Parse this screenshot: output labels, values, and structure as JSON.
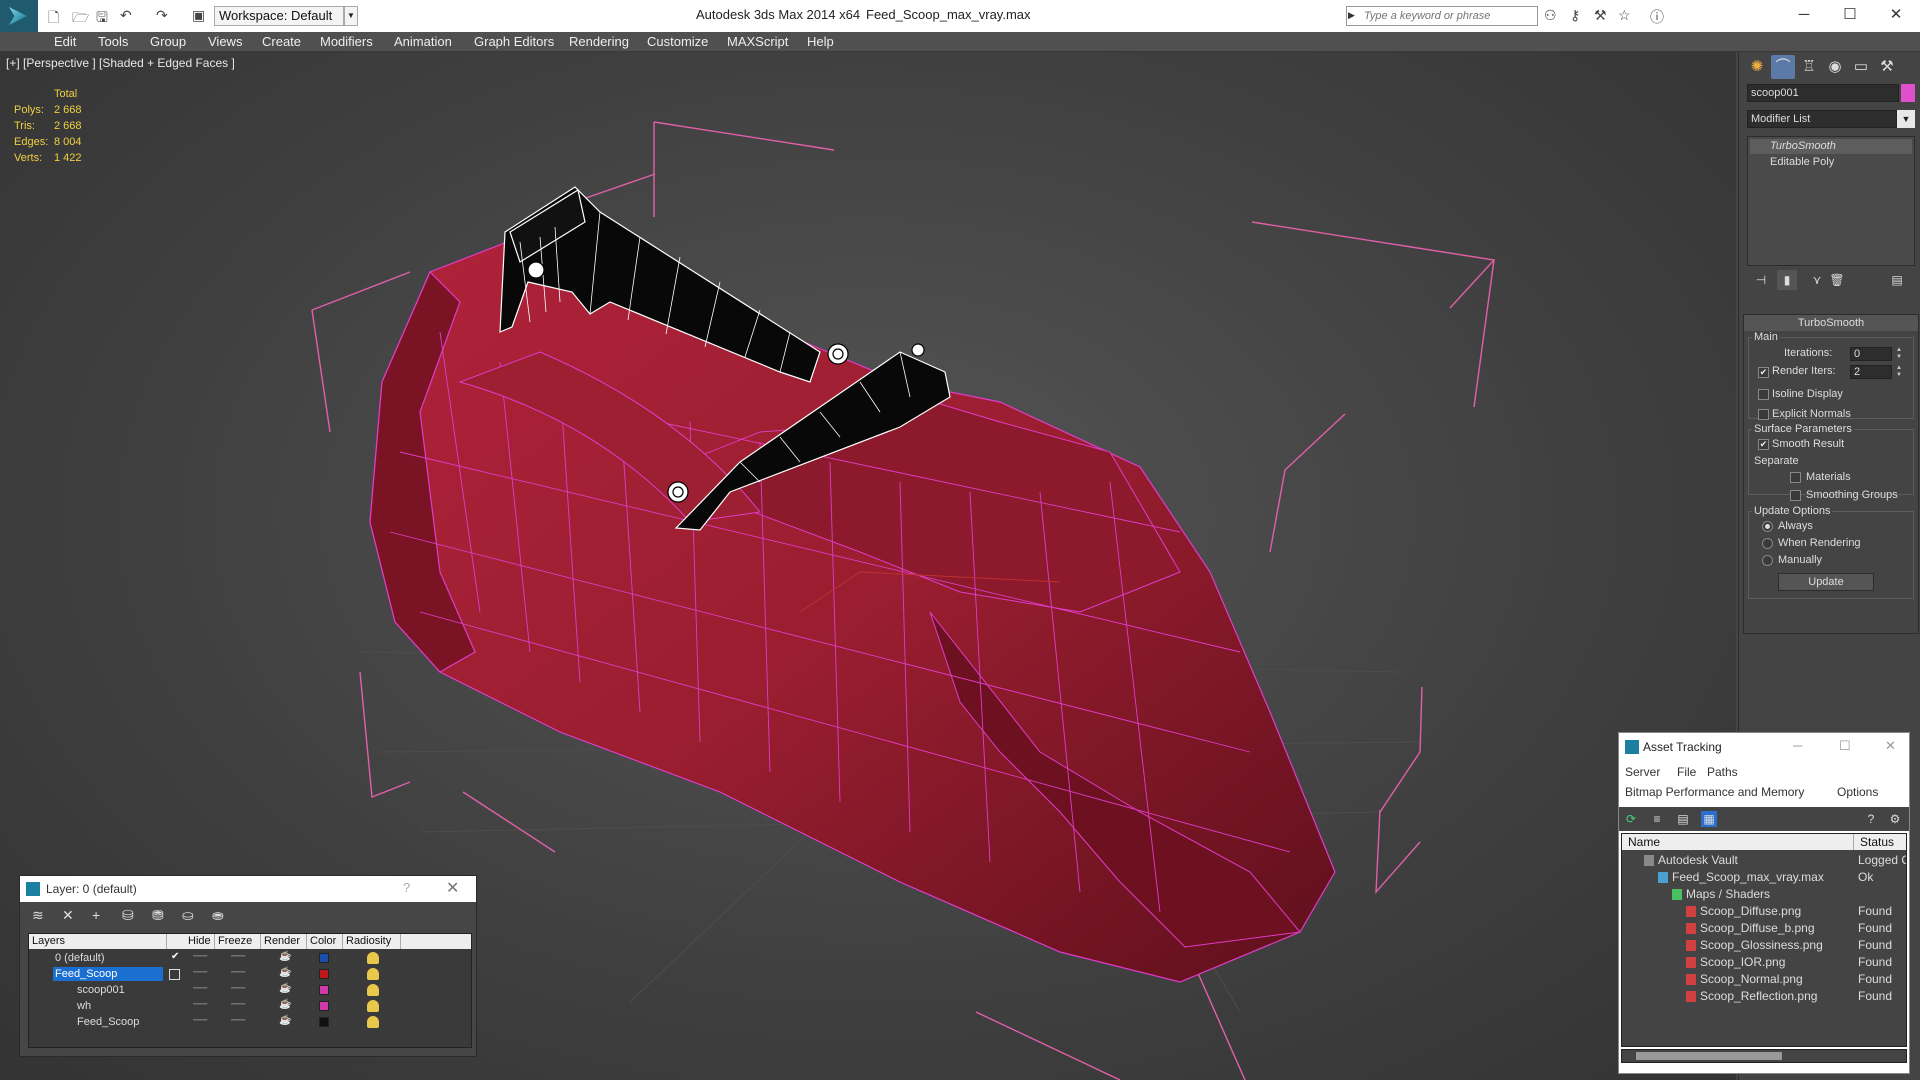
{
  "titlebar": {
    "workspace": "Workspace: Default",
    "app_title": "Autodesk 3ds Max  2014 x64",
    "file_title": "Feed_Scoop_max_vray.max",
    "search_placeholder": "Type a keyword or phrase"
  },
  "menu": [
    "Edit",
    "Tools",
    "Group",
    "Views",
    "Create",
    "Modifiers",
    "Animation",
    "Graph Editors",
    "Rendering",
    "Customize",
    "MAXScript",
    "Help"
  ],
  "viewport": {
    "label": "[+] [Perspective ] [Shaded + Edged Faces ]",
    "stats": {
      "header": "Total",
      "rows": [
        {
          "k": "Polys:",
          "v": "2 668"
        },
        {
          "k": "Tris:",
          "v": "2 668"
        },
        {
          "k": "Edges:",
          "v": "8 004"
        },
        {
          "k": "Verts:",
          "v": "1 422"
        }
      ]
    }
  },
  "command_panel": {
    "object_name": "scoop001",
    "object_color": "#e04fcc",
    "modifier_list": "Modifier List",
    "stack": [
      "TurboSmooth",
      "Editable Poly"
    ],
    "rollout": {
      "title": "TurboSmooth",
      "main": "Main",
      "iterations_label": "Iterations:",
      "iterations": "0",
      "render_iters_label": "Render Iters:",
      "render_iters": "2",
      "isoline": "Isoline Display",
      "explicit_normals": "Explicit Normals",
      "surface_params": "Surface Parameters",
      "smooth_result": "Smooth Result",
      "separate": "Separate",
      "materials": "Materials",
      "smoothing_groups": "Smoothing Groups",
      "update_options": "Update Options",
      "always": "Always",
      "when_rendering": "When Rendering",
      "manually": "Manually",
      "update_button": "Update"
    }
  },
  "layer_window": {
    "title": "Layer: 0 (default)",
    "help": "?",
    "columns": [
      "Layers",
      "Hide",
      "Freeze",
      "Render",
      "Color",
      "Radiosity"
    ],
    "rows": [
      {
        "name": "0 (default)",
        "color": "#1a4fb0",
        "checked": true
      },
      {
        "name": "Feed_Scoop",
        "color": "#c01818",
        "selected": true
      },
      {
        "name": "scoop001",
        "color": "#d03aa8"
      },
      {
        "name": "wh",
        "color": "#d03aa8"
      },
      {
        "name": "Feed_Scoop",
        "color": "#111111"
      }
    ]
  },
  "asset_window": {
    "title": "Asset Tracking",
    "menu1": [
      "Server",
      "File",
      "Paths"
    ],
    "menu2": [
      "Bitmap Performance and Memory",
      "Options"
    ],
    "columns": [
      "Name",
      "Status"
    ],
    "rows": [
      {
        "name": "Autodesk Vault",
        "status": "Logged O",
        "indent": 0
      },
      {
        "name": "Feed_Scoop_max_vray.max",
        "status": "Ok",
        "indent": 1
      },
      {
        "name": "Maps / Shaders",
        "status": "",
        "indent": 2
      },
      {
        "name": "Scoop_Diffuse.png",
        "status": "Found",
        "indent": 3
      },
      {
        "name": "Scoop_Diffuse_b.png",
        "status": "Found",
        "indent": 3
      },
      {
        "name": "Scoop_Glossiness.png",
        "status": "Found",
        "indent": 3
      },
      {
        "name": "Scoop_IOR.png",
        "status": "Found",
        "indent": 3
      },
      {
        "name": "Scoop_Normal.png",
        "status": "Found",
        "indent": 3
      },
      {
        "name": "Scoop_Reflection.png",
        "status": "Found",
        "indent": 3
      }
    ]
  }
}
